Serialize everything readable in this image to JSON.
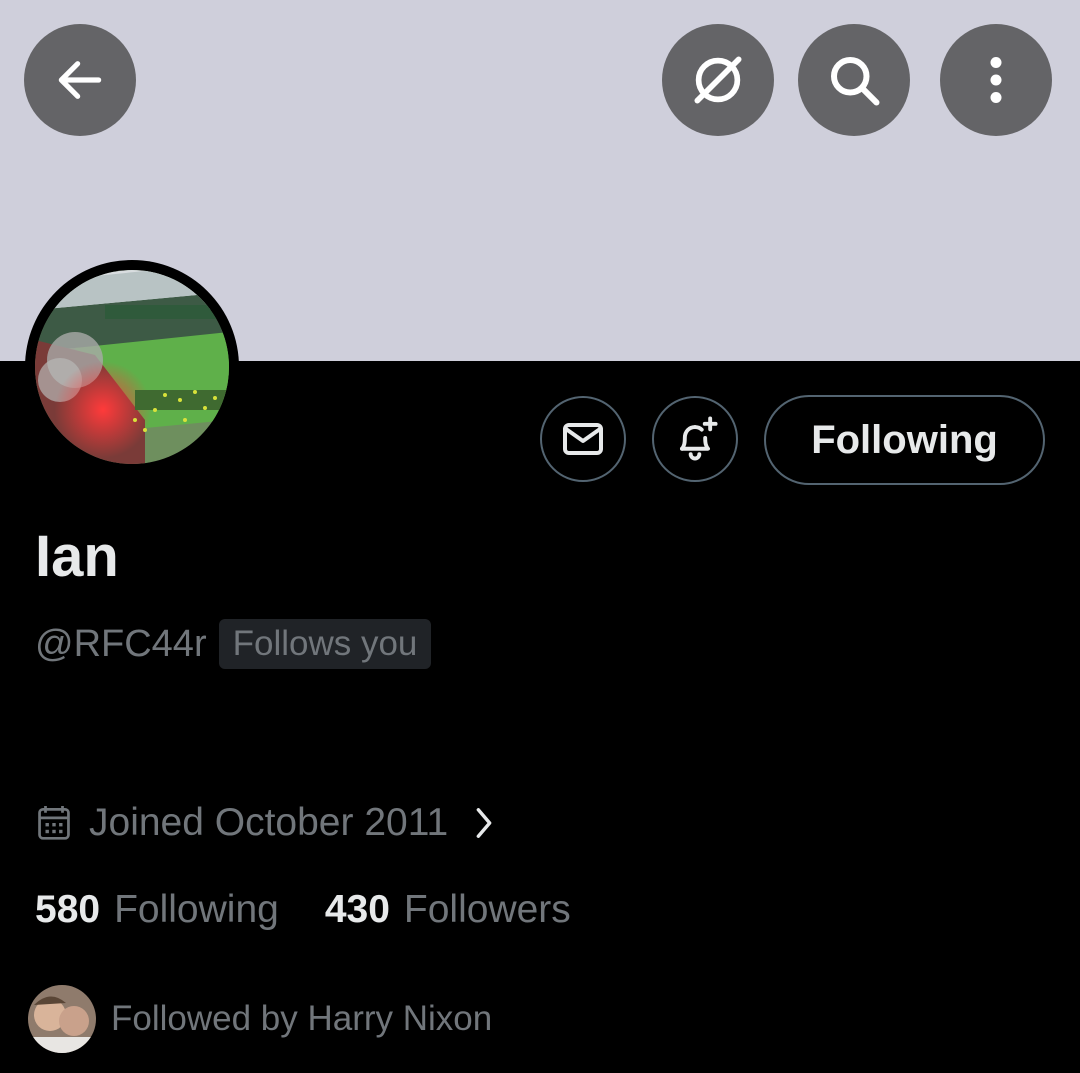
{
  "header": {
    "back_icon": "arrow-left-icon",
    "grok_icon": "grok-icon",
    "search_icon": "search-icon",
    "more_icon": "more-vertical-icon",
    "banner_color": "#cfcfdb"
  },
  "profile": {
    "avatar_alt": "stadium-crowd-photo",
    "display_name": "Ian",
    "handle": "@RFC44r",
    "follows_you_badge": "Follows you",
    "joined": "Joined October 2011",
    "following_count": "580",
    "following_label": "Following",
    "followers_count": "430",
    "followers_label": "Followers",
    "followed_by": "Followed by Harry Nixon"
  },
  "actions": {
    "message_icon": "envelope-icon",
    "notify_icon": "bell-plus-icon",
    "following_button": "Following"
  },
  "colors": {
    "background": "#000000",
    "text_primary": "#e7e9ea",
    "text_secondary": "#71767b",
    "border": "#536471",
    "badge_bg": "#202327"
  }
}
